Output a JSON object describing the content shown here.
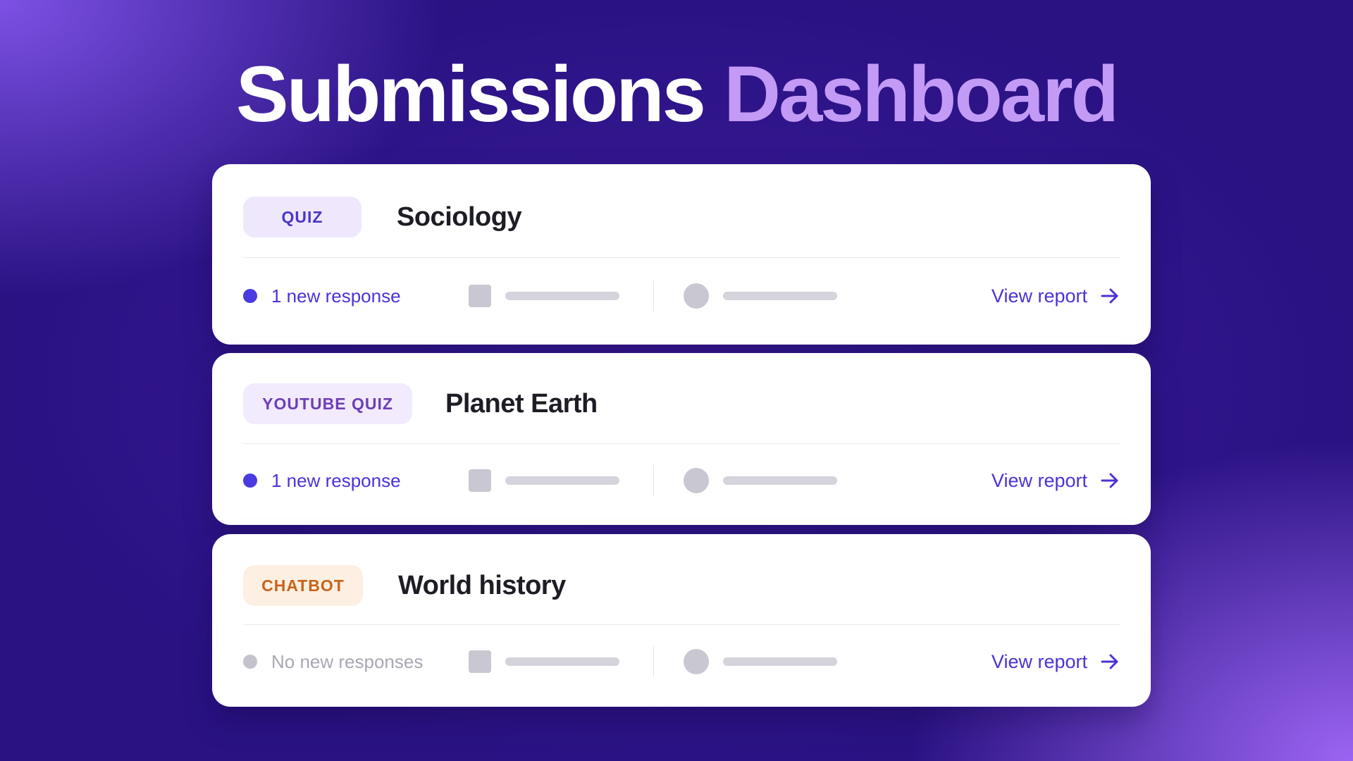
{
  "header": {
    "title_part1": "Submissions",
    "title_part2": "Dashboard"
  },
  "colors": {
    "accent": "#4a33d6",
    "title_highlight": "#c39af5",
    "quiz_badge": "#4b36c9",
    "youtube_badge": "#6b3fb8",
    "chatbot_badge": "#c7641b"
  },
  "cards": [
    {
      "badge": "QUIZ",
      "title": "Sociology",
      "status": "1 new response",
      "status_active": true,
      "action": "View report",
      "action_icon": "arrow-right-icon"
    },
    {
      "badge": "YOUTUBE QUIZ",
      "title": "Planet Earth",
      "status": "1 new response",
      "status_active": true,
      "action": "View report",
      "action_icon": "arrow-right-icon"
    },
    {
      "badge": "CHATBOT",
      "title": "World history",
      "status": "No new responses",
      "status_active": false,
      "action": "View report",
      "action_icon": "arrow-right-icon"
    }
  ]
}
